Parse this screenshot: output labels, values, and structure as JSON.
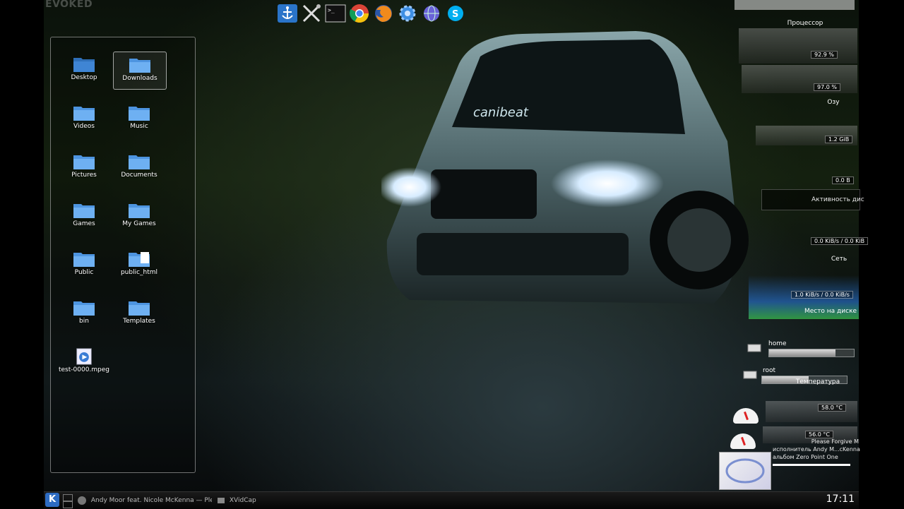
{
  "desktop": {
    "overlay_text": "EVOKED",
    "folder_view": {
      "items": [
        {
          "label": "Desktop",
          "icon": "desktop-folder-icon",
          "selected": false
        },
        {
          "label": "Downloads",
          "icon": "folder-icon",
          "selected": true
        },
        {
          "label": "Videos",
          "icon": "folder-icon",
          "selected": false
        },
        {
          "label": "Music",
          "icon": "folder-icon",
          "selected": false
        },
        {
          "label": "Pictures",
          "icon": "folder-icon",
          "selected": false
        },
        {
          "label": "Documents",
          "icon": "folder-icon",
          "selected": false
        },
        {
          "label": "Games",
          "icon": "folder-icon",
          "selected": false
        },
        {
          "label": "My Games",
          "icon": "folder-icon",
          "selected": false
        },
        {
          "label": "Public",
          "icon": "folder-icon",
          "selected": false
        },
        {
          "label": "public_html",
          "icon": "html-folder-icon",
          "selected": false
        },
        {
          "label": "bin",
          "icon": "folder-icon",
          "selected": false
        },
        {
          "label": "Templates",
          "icon": "folder-icon",
          "selected": false
        },
        {
          "label": "test-0000.mpeg",
          "icon": "video-file-icon",
          "selected": false
        }
      ]
    },
    "car_text": "canibeat"
  },
  "launcher": {
    "icons": [
      "anchor-icon",
      "tools-icon",
      "terminal-icon",
      "chrome-icon",
      "firefox-icon",
      "settings-gear-icon",
      "globe-icon",
      "skype-icon"
    ]
  },
  "system_monitor": {
    "cpu": {
      "title": "Процессор",
      "core1": "92.9 %",
      "core2": "97.0 %"
    },
    "ram": {
      "title": "Озу",
      "value": "1.2 GiB",
      "swap": "0.0 B"
    },
    "disk_activity": {
      "title": "Активность дис",
      "value": "0.0 KiB/s / 0.0 KiB"
    },
    "network": {
      "title": "Сеть",
      "value": "1.0 KiB/s / 0.0 KiB/s"
    },
    "disk_space": {
      "title": "Место на диске",
      "volumes": [
        {
          "label": "home",
          "used_fraction": 0.78
        },
        {
          "label": "root",
          "used_fraction": 0.55
        }
      ]
    },
    "temperature": {
      "title": "Температура",
      "sensors": [
        {
          "value": "58.0 °C",
          "level": 0.58
        },
        {
          "value": "56.0 °C",
          "level": 0.56
        }
      ]
    },
    "now_playing": {
      "title": "Please Forgive M",
      "artist_line": "исполнитель Andy M...cKenna",
      "album_line": "альбом Zero Point One"
    }
  },
  "taskbar": {
    "kmenu_label": "K",
    "tasks": [
      {
        "label": "Andy Moor feat. Nicole McKenna — Plea",
        "icon": "music-player-icon"
      },
      {
        "label": "XVidCap",
        "icon": "camera-icon"
      }
    ],
    "clock": "17:11"
  },
  "colors": {
    "folder_blue": "#5aa0e6",
    "accent": "#2d6bc2"
  }
}
